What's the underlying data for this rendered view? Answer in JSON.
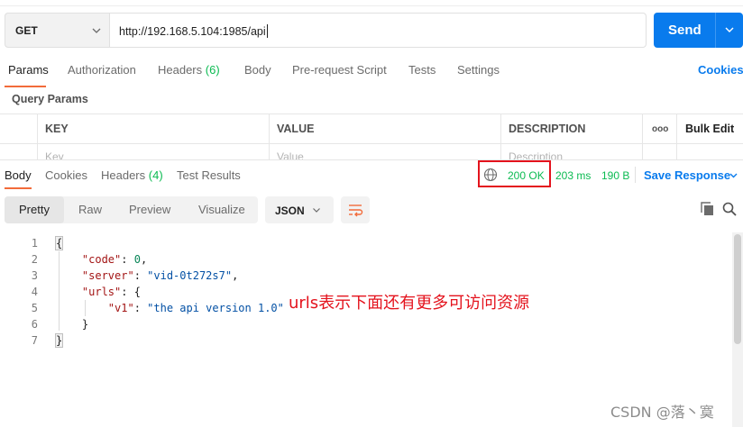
{
  "request": {
    "method": "GET",
    "url": "http://192.168.5.104:1985/api",
    "send_label": "Send"
  },
  "request_tabs": [
    {
      "label": "Params",
      "count": ""
    },
    {
      "label": "Authorization",
      "count": ""
    },
    {
      "label": "Headers",
      "count": "(6)"
    },
    {
      "label": "Body",
      "count": ""
    },
    {
      "label": "Pre-request Script",
      "count": ""
    },
    {
      "label": "Tests",
      "count": ""
    },
    {
      "label": "Settings",
      "count": ""
    }
  ],
  "cookies_label": "Cookies",
  "query_params": {
    "title": "Query Params",
    "columns": [
      "KEY",
      "VALUE",
      "DESCRIPTION"
    ],
    "more_icon_label": "ooo",
    "bulk_edit_label": "Bulk Edit",
    "placeholders": {
      "key": "Key",
      "value": "Value",
      "description": "Description"
    }
  },
  "response_tabs": [
    {
      "label": "Body",
      "count": ""
    },
    {
      "label": "Cookies",
      "count": ""
    },
    {
      "label": "Headers",
      "count": "(4)"
    },
    {
      "label": "Test Results",
      "count": ""
    }
  ],
  "status": {
    "code_text": "200 OK",
    "time": "203 ms",
    "size": "190 B",
    "save_label": "Save Response"
  },
  "view_modes": [
    "Pretty",
    "Raw",
    "Preview",
    "Visualize"
  ],
  "format": "JSON",
  "line_numbers": [
    "1",
    "2",
    "3",
    "4",
    "5",
    "6",
    "7"
  ],
  "json_body": {
    "open_brace": "{",
    "code_key": "\"code\"",
    "code_val": "0",
    "server_key": "\"server\"",
    "server_val": "\"vid-0t272s7\"",
    "urls_key": "\"urls\"",
    "v1_key": "\"v1\"",
    "v1_val": "\"the api version 1.0\"",
    "inner_close": "}",
    "close_brace": "}"
  },
  "annotation_note": "urls表示下面还有更多可访问资源",
  "watermark": "CSDN @落丶寞",
  "colors": {
    "accent_blue": "#097bed",
    "tab_orange": "#f26b3a",
    "status_green": "#0cbb52",
    "highlight_red": "#e4131d"
  }
}
